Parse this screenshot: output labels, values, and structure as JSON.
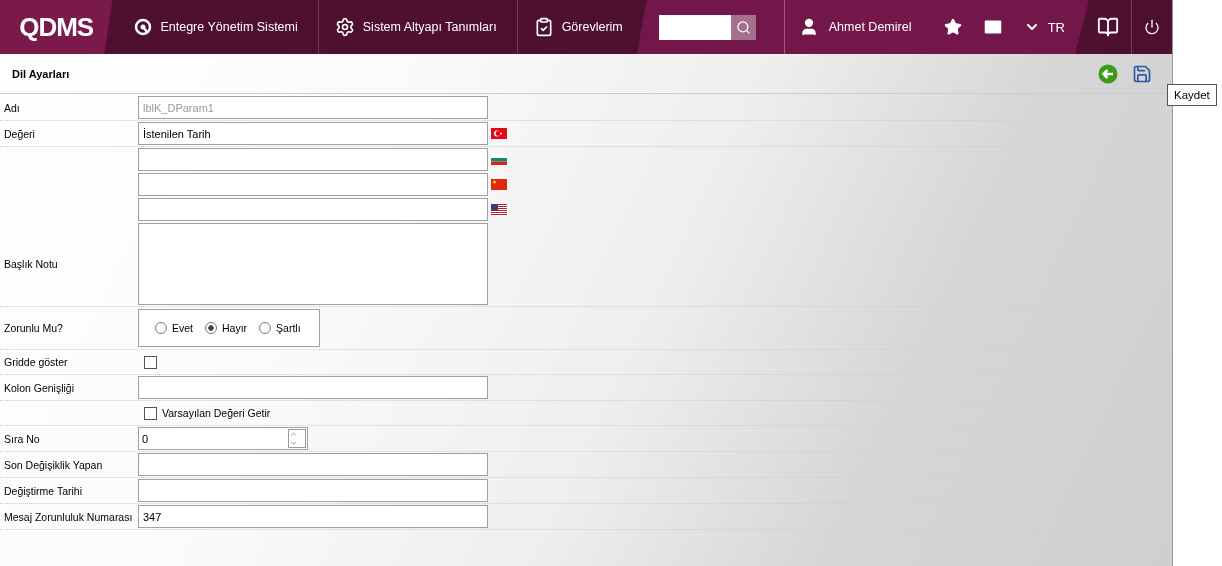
{
  "header": {
    "logo": "QDMS",
    "nav": [
      {
        "label": "Entegre Yönetim Sistemi"
      },
      {
        "label": "Sistem Altyapı Tanımları"
      },
      {
        "label": "Görevlerim"
      }
    ],
    "user": "Ahmet Demirel",
    "language": "TR"
  },
  "page": {
    "title": "Dil Ayarları",
    "tooltip": "Kaydet"
  },
  "fields": [
    {
      "kind": "text",
      "label": "Adı",
      "value": "lblK_DParam1",
      "disabled": true
    },
    {
      "kind": "translation",
      "label": "Değeri",
      "value": "İstenilen Tarih"
    },
    {
      "kind": "translation"
    },
    {
      "kind": "translation"
    },
    {
      "kind": "translation"
    },
    {
      "kind": "textarea",
      "label": "Başlık Notu"
    },
    {
      "kind": "radio",
      "label": "Zorunlu Mu?",
      "options": [
        {
          "label": "Evet",
          "selected": false
        },
        {
          "label": "Hayır",
          "selected": true
        },
        {
          "label": "Şartlı",
          "selected": false
        }
      ]
    },
    {
      "kind": "checkbox",
      "label": "Gridde göster",
      "checked": false
    },
    {
      "kind": "text",
      "label": "Kolon Genişliği"
    },
    {
      "kind": "checkbox",
      "text": "Varsayılan Değeri Getir",
      "checked": false
    },
    {
      "kind": "spin",
      "label": "Sıra No",
      "value": "0"
    },
    {
      "kind": "text",
      "label": "Son Değişiklik Yapan"
    },
    {
      "kind": "text",
      "label": "Değiştirme Tarihi"
    },
    {
      "kind": "text",
      "label": "Mesaj Zorunluluk Numarası",
      "value": "347"
    }
  ]
}
